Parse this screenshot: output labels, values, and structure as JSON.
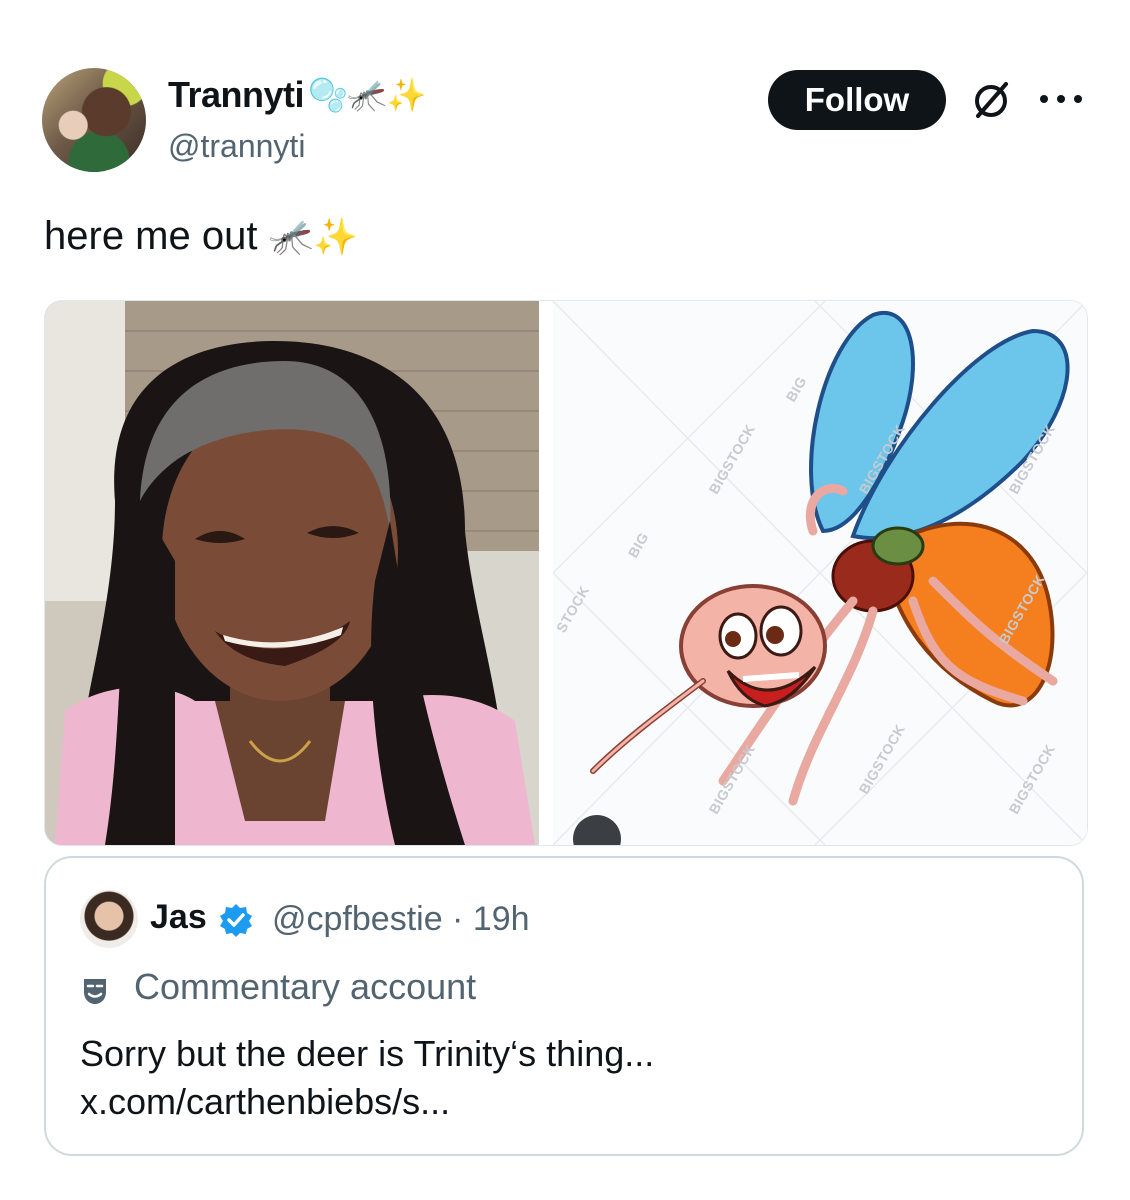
{
  "author": {
    "display_name": "Trannyti",
    "name_emoji": "🫧🦟✨",
    "handle": "@trannyti"
  },
  "header": {
    "follow_label": "Follow"
  },
  "tweet": {
    "text": "here me out",
    "text_emoji": "🦟✨"
  },
  "media": {
    "watermarks": [
      "BIGSTOCK",
      "BIG",
      "BIGSTOCK",
      "BIG",
      "BIGSTOCK",
      "BIGSTOCK",
      "BIGSTOCK",
      "BIGSTOCK",
      "BIGSTOCK",
      "STOCK"
    ]
  },
  "quote": {
    "name": "Jas",
    "handle_time": "@cpfbestie · 19h",
    "label": "Commentary account",
    "text_line1": "Sorry but the deer is Trinity‘s thing...",
    "text_line2": "x.com/carthenbiebs/s..."
  },
  "colors": {
    "follow_bg": "#0f1419",
    "secondary_text": "#536471",
    "verified_blue": "#1d9bf0",
    "quote_border": "#cfd9de"
  }
}
